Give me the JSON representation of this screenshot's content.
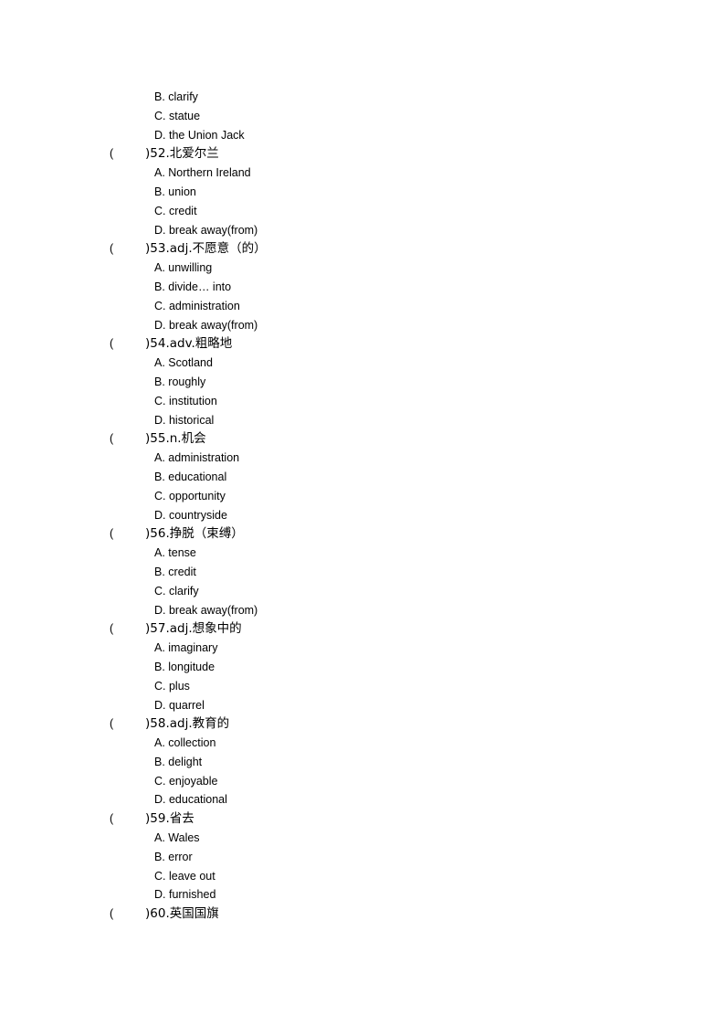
{
  "leading_options": [
    "B. clarify",
    "C. statue",
    "D. the Union Jack"
  ],
  "questions": [
    {
      "number": "52",
      "prompt": ")52.北爱尔兰",
      "options": [
        "A. Northern Ireland",
        "B. union",
        "C. credit",
        "D. break away(from)"
      ]
    },
    {
      "number": "53",
      "prompt": ")53.adj.不愿意（的）",
      "options": [
        "A. unwilling",
        "B. divide… into",
        "C. administration",
        "D. break away(from)"
      ]
    },
    {
      "number": "54",
      "prompt": ")54.adv.粗略地",
      "options": [
        "A. Scotland",
        "B. roughly",
        "C. institution",
        "D. historical"
      ]
    },
    {
      "number": "55",
      "prompt": ")55.n.机会",
      "options": [
        "A. administration",
        "B. educational",
        "C. opportunity",
        "D. countryside"
      ]
    },
    {
      "number": "56",
      "prompt": ")56.挣脱（束缚）",
      "options": [
        "A. tense",
        "B. credit",
        "C. clarify",
        "D. break away(from)"
      ]
    },
    {
      "number": "57",
      "prompt": ")57.adj.想象中的",
      "options": [
        "A. imaginary",
        "B. longitude",
        "C. plus",
        "D. quarrel"
      ]
    },
    {
      "number": "58",
      "prompt": ")58.adj.教育的",
      "options": [
        "A. collection",
        "B. delight",
        "C. enjoyable",
        "D. educational"
      ]
    },
    {
      "number": "59",
      "prompt": ")59.省去",
      "options": [
        "A. Wales",
        "B. error",
        "C. leave out",
        "D. furnished"
      ]
    },
    {
      "number": "60",
      "prompt": ")60.英国国旗",
      "options": []
    }
  ],
  "answer_paren_open": "("
}
